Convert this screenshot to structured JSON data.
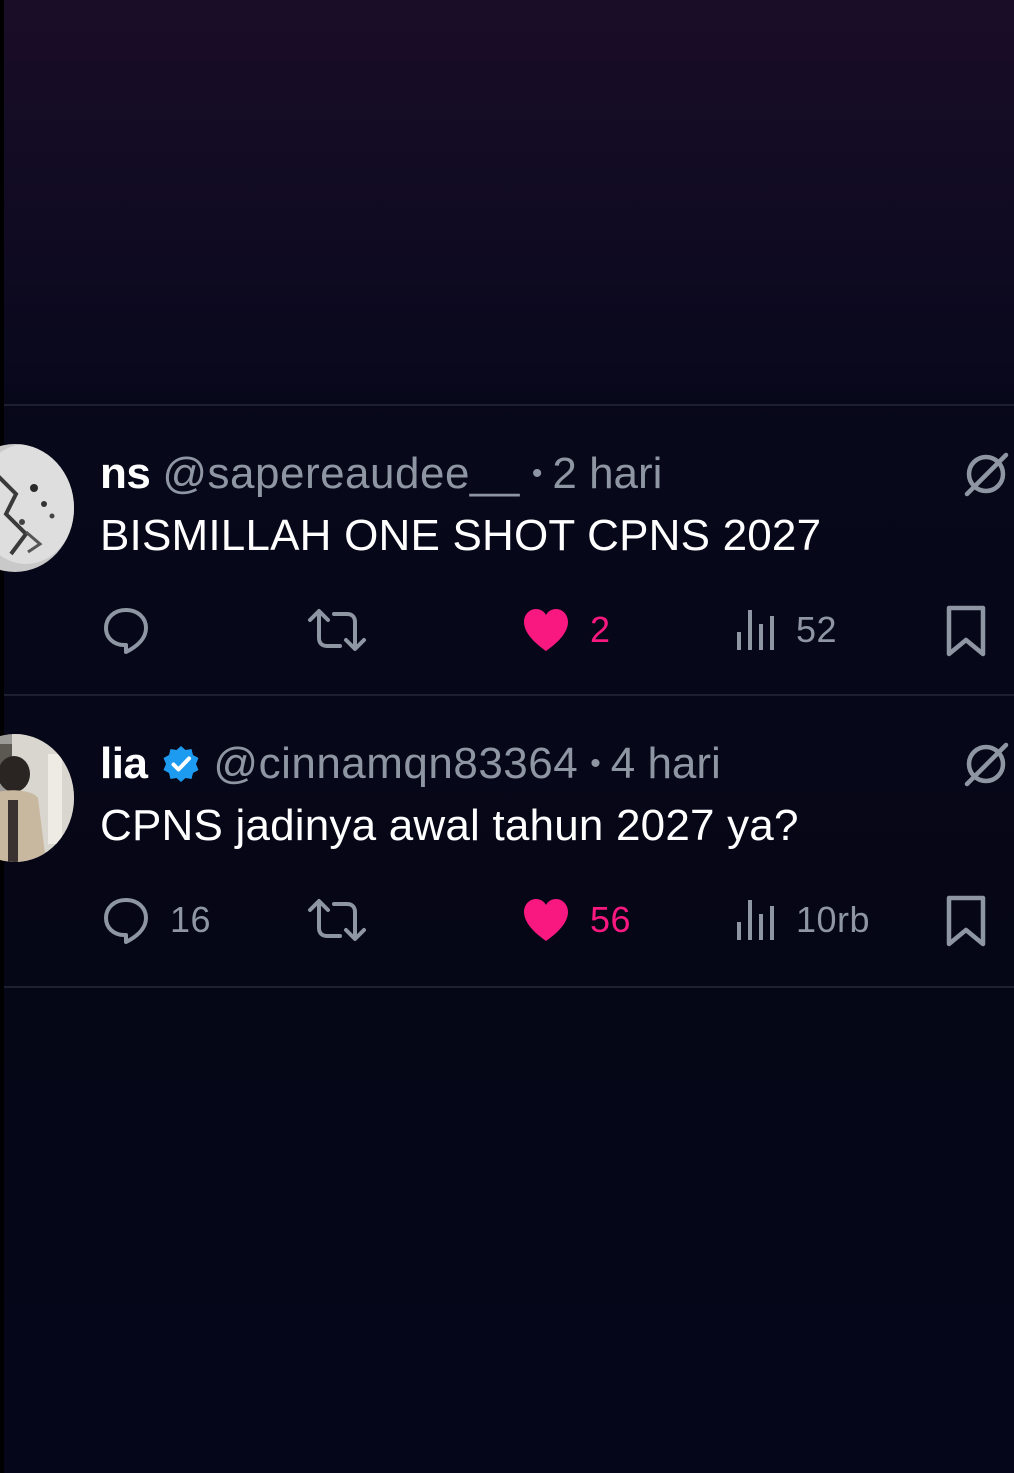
{
  "posts": [
    {
      "display_name": "ns",
      "handle": "@sapereaudee__",
      "separator": "•",
      "time": "2 hari",
      "verified": false,
      "text": "BISMILLAH ONE SHOT CPNS 2027",
      "replies": "",
      "reposts": "",
      "likes": "2",
      "liked": true,
      "views": "52"
    },
    {
      "display_name": "lia",
      "handle": "@cinnamqn83364",
      "separator": "•",
      "time": "4 hari",
      "verified": true,
      "text": "CPNS jadinya awal tahun 2027 ya?",
      "replies": "16",
      "reposts": "",
      "likes": "56",
      "liked": true,
      "views": "10rb"
    }
  ],
  "colors": {
    "background": "#05061a",
    "text_primary": "#ffffff",
    "text_secondary": "#8f96a3",
    "like_pink": "#f91880",
    "verified_blue": "#1d9bf0",
    "divider": "#1d2030"
  },
  "icons": {
    "reply": "speech-bubble",
    "repost": "two-arrows-loop",
    "like": "heart-filled",
    "views": "bar-chart",
    "bookmark": "bookmark-outline",
    "grok": "circle-slash"
  }
}
